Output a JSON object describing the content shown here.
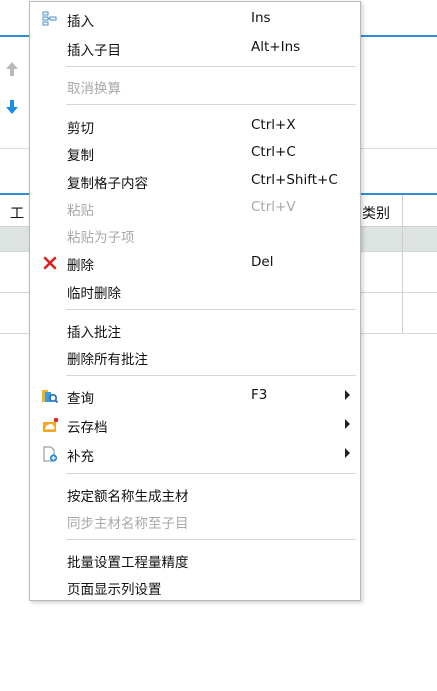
{
  "background": {
    "header_left": "工",
    "header_right": "类别"
  },
  "menu": {
    "insert": {
      "label": "插入",
      "shortcut": "Ins",
      "icon": "insert-rows-icon"
    },
    "insert_child": {
      "label": "插入子目",
      "shortcut": "Alt+Ins"
    },
    "cancel_convert": {
      "label": "取消换算"
    },
    "cut": {
      "label": "剪切",
      "shortcut": "Ctrl+X"
    },
    "copy": {
      "label": "复制",
      "shortcut": "Ctrl+C"
    },
    "copy_cell": {
      "label": "复制格子内容",
      "shortcut": "Ctrl+Shift+C"
    },
    "paste": {
      "label": "粘贴",
      "shortcut": "Ctrl+V"
    },
    "paste_child": {
      "label": "粘贴为子项"
    },
    "delete": {
      "label": "删除",
      "shortcut": "Del",
      "icon": "red-x-icon"
    },
    "temp_delete": {
      "label": "临时删除"
    },
    "insert_note": {
      "label": "插入批注"
    },
    "delete_notes": {
      "label": "删除所有批注"
    },
    "query": {
      "label": "查询",
      "shortcut": "F3",
      "icon": "folder-search-icon"
    },
    "cloud_archive": {
      "label": "云存档",
      "icon": "cloud-archive-icon"
    },
    "supplement": {
      "label": "补充",
      "icon": "document-add-icon"
    },
    "gen_main_material": {
      "label": "按定额名称生成主材"
    },
    "sync_main_material": {
      "label": "同步主材名称至子目"
    },
    "batch_precision": {
      "label": "批量设置工程量精度"
    },
    "column_settings": {
      "label": "页面显示列设置"
    }
  },
  "colors": {
    "accent": "#2a8fd6",
    "delete_icon": "#e02020",
    "disabled_text": "#a8a8a8",
    "selected_row": "#dde3e0"
  }
}
